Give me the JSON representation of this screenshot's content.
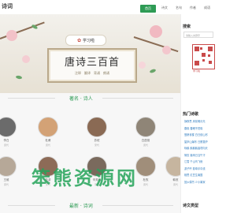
{
  "header": {
    "logo": "诗词",
    "nav": [
      "首页",
      "诗文",
      "名句",
      "作者",
      "成语"
    ]
  },
  "banner": {
    "brand": "学习啦",
    "title": "唐诗三百首",
    "tags": [
      "注释",
      "翻译",
      "背诵",
      "朗诵"
    ]
  },
  "sections": {
    "poets_title": "著名 · 诗人",
    "latest_title": "最新 · 诗词"
  },
  "poets": [
    {
      "name": "李白",
      "dynasty": "唐代"
    },
    {
      "name": "杜甫",
      "dynasty": "唐代"
    },
    {
      "name": "苏轼",
      "dynasty": "宋代"
    },
    {
      "name": "白居易",
      "dynasty": "唐代"
    },
    {
      "name": "王维",
      "dynasty": "唐代"
    },
    {
      "name": "陆游",
      "dynasty": "宋代"
    },
    {
      "name": "辛弃疾",
      "dynasty": "宋代"
    },
    {
      "name": "杜牧",
      "dynasty": "唐代"
    },
    {
      "name": "韩愈",
      "dynasty": "唐代"
    }
  ],
  "sidebar": {
    "search_label": "搜索",
    "search_placeholder": "请输入关键字",
    "qr_label": "学习啦",
    "hot_title": "热门诗歌",
    "hot_items": [
      "静夜思 床前明月光",
      "春晓 春眠不觉晓",
      "登鹳雀楼 白日依山尽",
      "望庐山瀑布 日照香炉",
      "咏鹅 鹅鹅鹅曲项向天",
      "悯农 锄禾日当午汗",
      "江雪 千山鸟飞绝",
      "游子吟 慈母手中线",
      "相思 红豆生南国",
      "回乡偶书 少小离家"
    ],
    "types_title": "诗文类型"
  },
  "watermark": "笨熊资源网"
}
